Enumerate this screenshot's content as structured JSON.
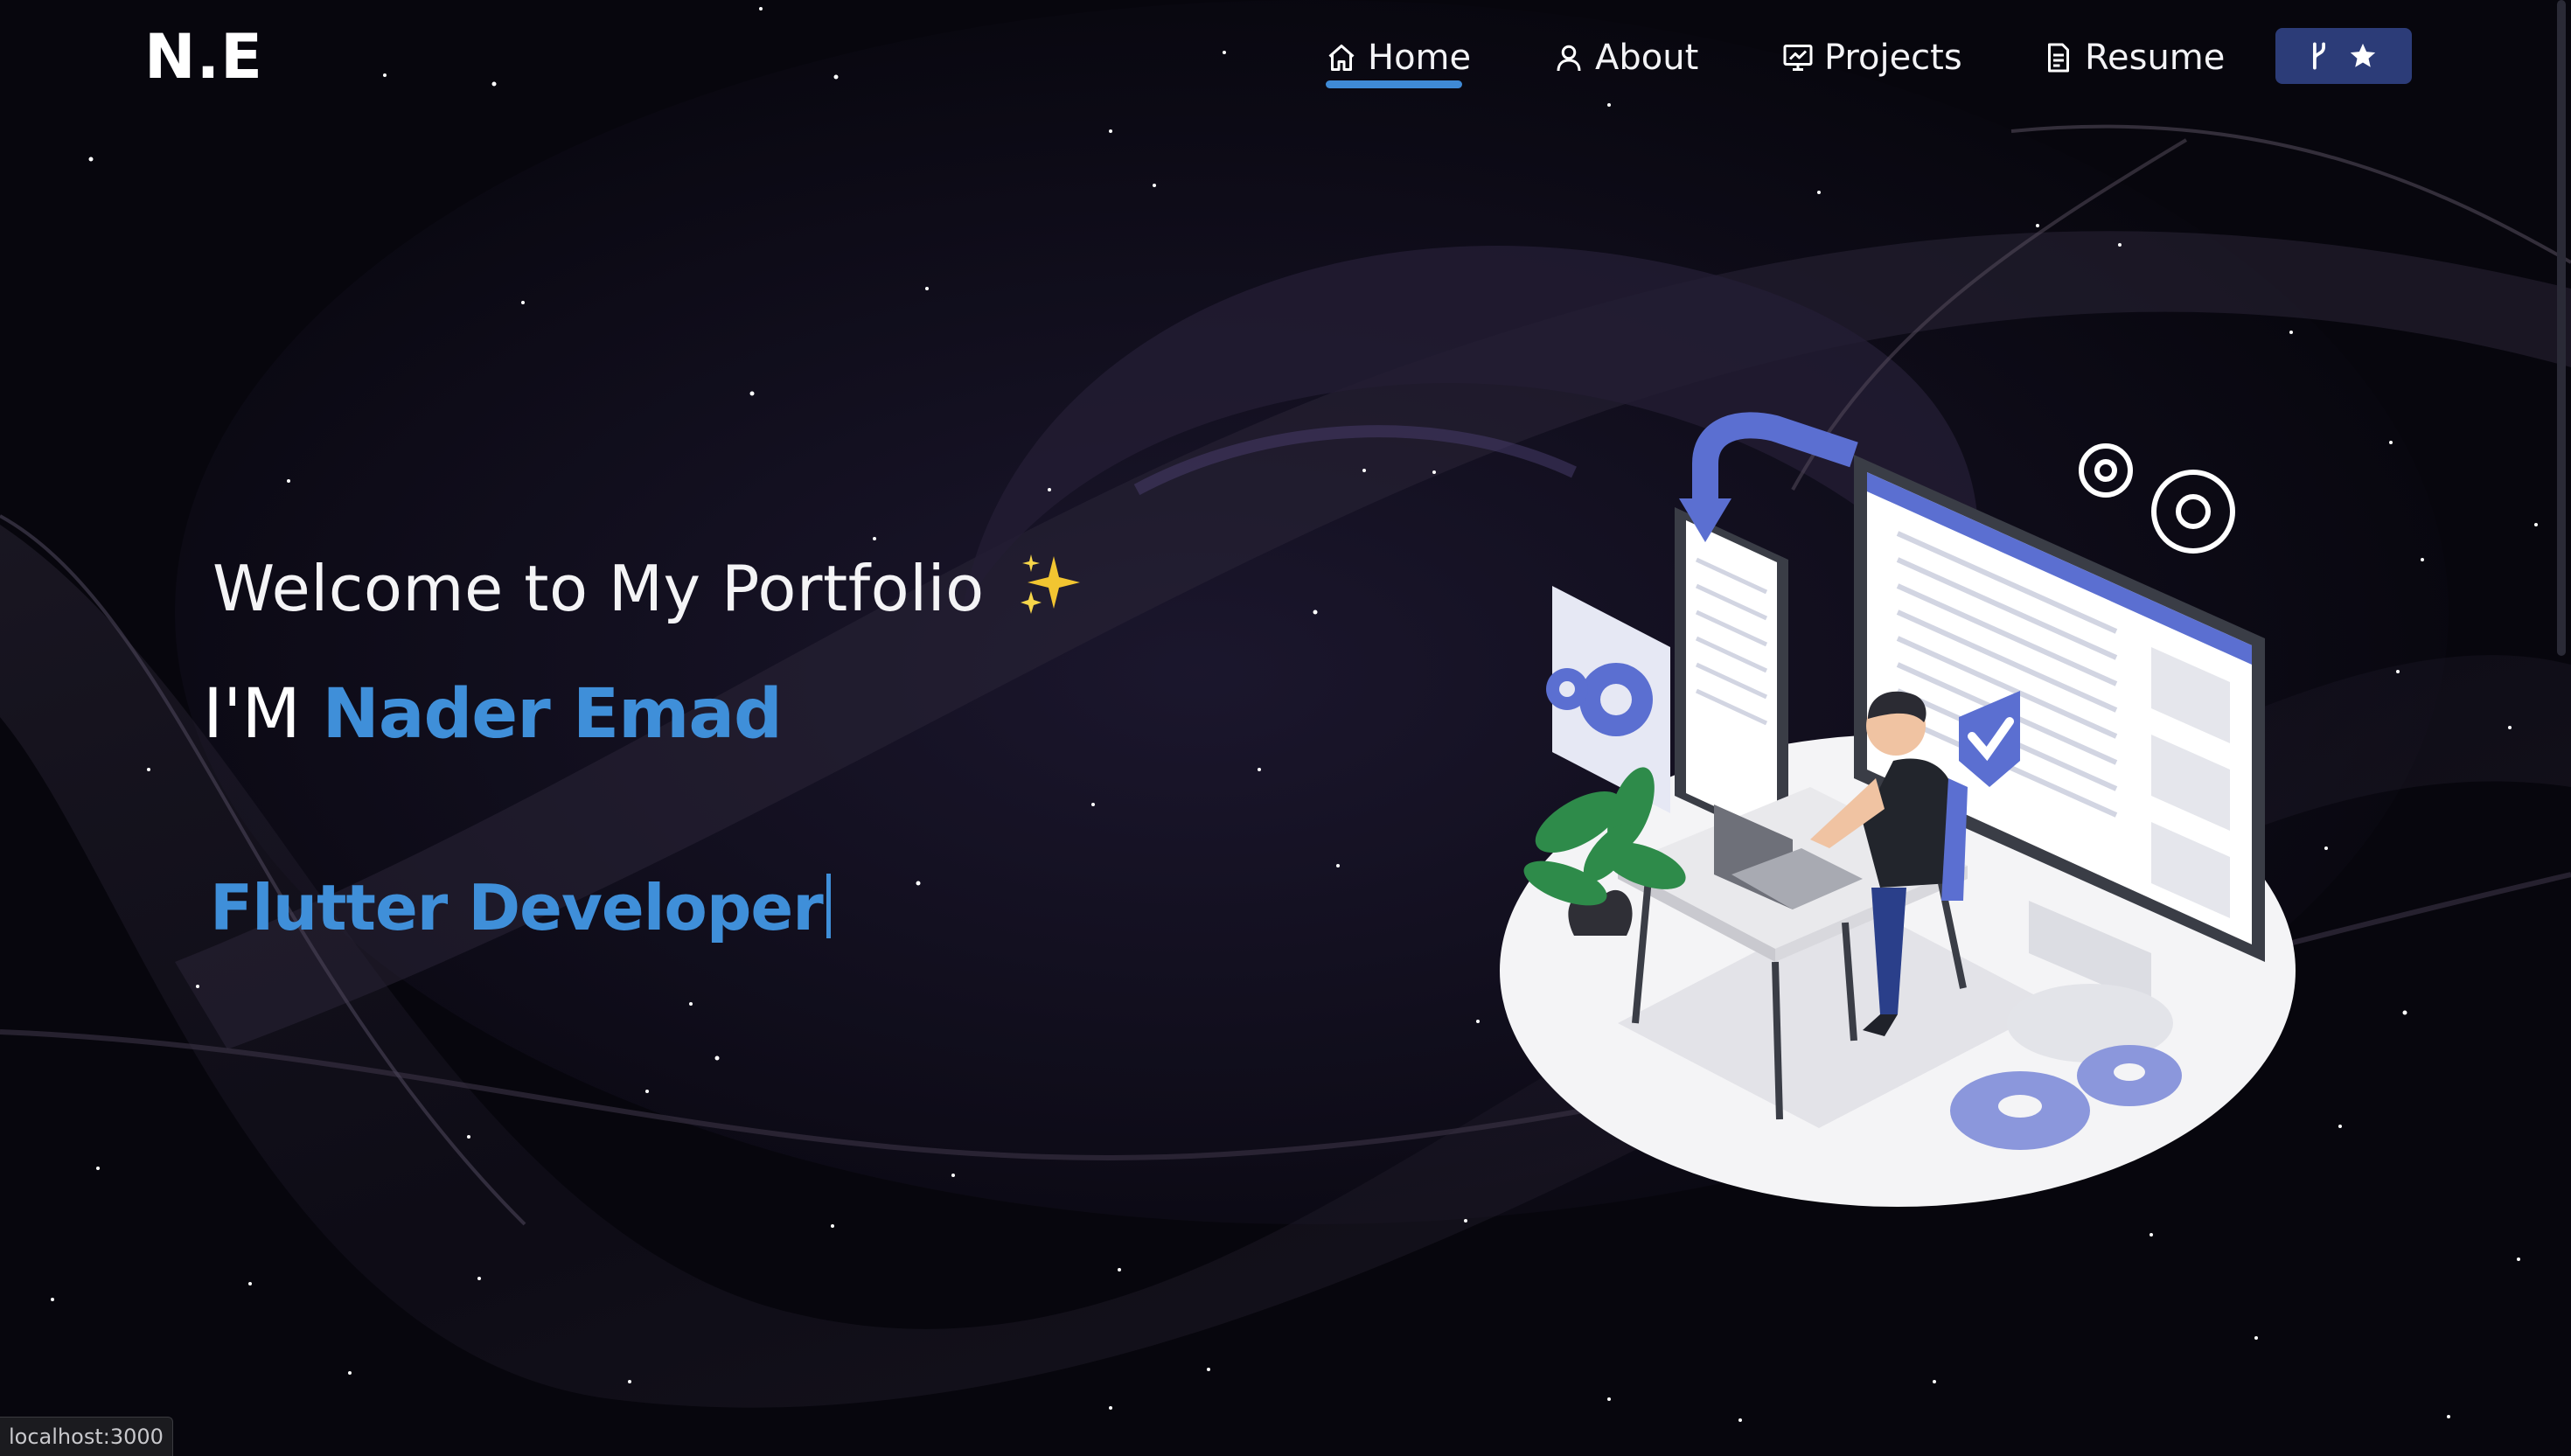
{
  "nav": {
    "logo": "N.E",
    "items": [
      {
        "label": "Home",
        "icon": "home-icon",
        "active": true
      },
      {
        "label": "About",
        "icon": "user-icon"
      },
      {
        "label": "Projects",
        "icon": "projects-icon"
      },
      {
        "label": "Resume",
        "icon": "document-icon"
      }
    ],
    "github_button": {
      "icons": [
        "fork-icon",
        "star-icon"
      ]
    }
  },
  "hero": {
    "welcome": "Welcome to My Portfolio",
    "intro_prefix": "I'M",
    "name": "Nader Emad",
    "role": "Flutter Developer"
  },
  "status_bar": {
    "url": "localhost:3000"
  },
  "colors": {
    "accent": "#3f8fd9",
    "button_bg": "#2c3c78",
    "background": "#07060d",
    "illustration_blue": "#5b6fd1"
  }
}
